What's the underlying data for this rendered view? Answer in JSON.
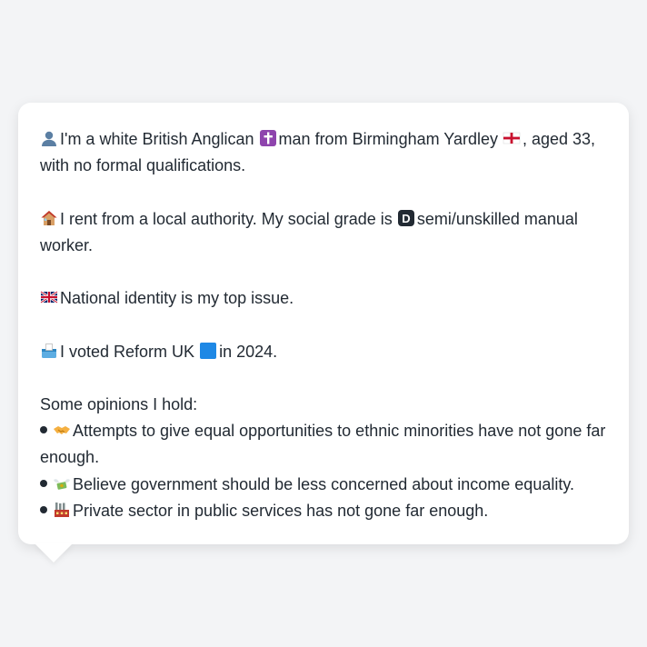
{
  "colors": {
    "background": "#f3f4f6",
    "bubble": "#ffffff",
    "text": "#222a33"
  },
  "profile": {
    "p1": {
      "before": "I'm a white British Anglican",
      "middle": "man from Birmingham Yardley",
      "after": ", aged 33, with no formal qualifications."
    },
    "p2": {
      "before": "I rent from a local authority. My social grade is",
      "after": "semi/unskilled manual worker."
    },
    "p3": {
      "text": "National identity is my top issue."
    },
    "p4": {
      "before": "I voted Reform UK",
      "after": "in 2024."
    },
    "opinions": {
      "heading": "Some opinions I hold:",
      "items": [
        "Attempts to give equal opportunities to ethnic minorities have not gone far enough.",
        "Believe government should be less concerned about income equality.",
        "Private sector in public services has not gone far enough."
      ]
    }
  },
  "icons": {
    "person": "bust-silhouette-icon",
    "religion": "latin-cross-icon",
    "flag_england": "england-flag-icon",
    "house": "house-icon",
    "grade": "letter-d-icon",
    "flag_uk": "uk-flag-icon",
    "ballot": "ballot-box-icon",
    "party": "blue-square-icon",
    "opinion_1": "handshake-icon",
    "opinion_2": "money-with-wings-icon",
    "opinion_3": "factory-icon"
  },
  "grade_letter": "D"
}
